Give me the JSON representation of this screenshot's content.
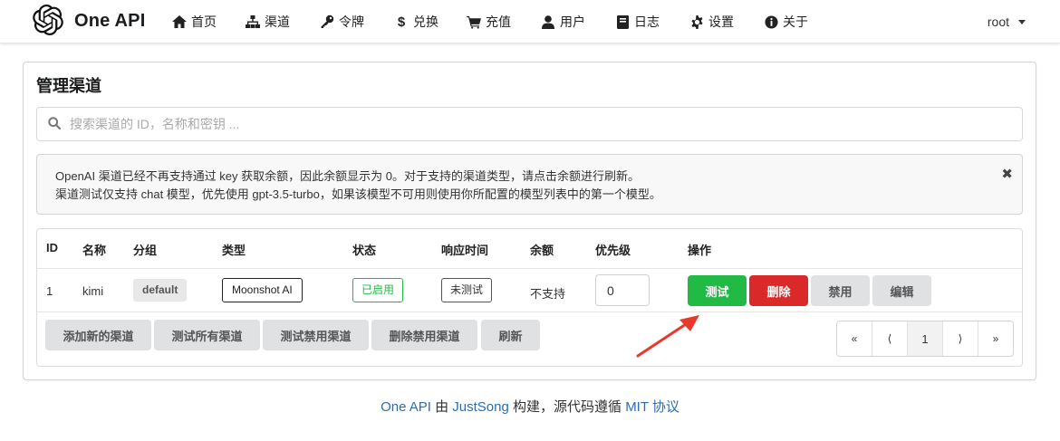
{
  "brand": {
    "name": "One API"
  },
  "nav": [
    {
      "label": "首页",
      "icon": "home-icon"
    },
    {
      "label": "渠道",
      "icon": "sitemap-icon"
    },
    {
      "label": "令牌",
      "icon": "key-icon"
    },
    {
      "label": "兑换",
      "icon": "dollar-icon"
    },
    {
      "label": "充值",
      "icon": "cart-icon"
    },
    {
      "label": "用户",
      "icon": "user-icon"
    },
    {
      "label": "日志",
      "icon": "book-icon"
    },
    {
      "label": "设置",
      "icon": "gear-icon"
    },
    {
      "label": "关于",
      "icon": "info-icon"
    }
  ],
  "user": {
    "name": "root"
  },
  "page": {
    "title": "管理渠道",
    "search_placeholder": "搜索渠道的 ID，名称和密钥 ...",
    "notice_line1": "OpenAI 渠道已经不再支持通过 key 获取余额，因此余额显示为 0。对于支持的渠道类型，请点击余额进行刷新。",
    "notice_line2": "渠道测试仅支持 chat 模型，优先使用 gpt-3.5-turbo，如果该模型不可用则使用你所配置的模型列表中的第一个模型。",
    "notice_close": "✖"
  },
  "table": {
    "headers": [
      "ID",
      "名称",
      "分组",
      "类型",
      "状态",
      "响应时间",
      "余额",
      "优先级",
      "操作"
    ],
    "rows": [
      {
        "id": "1",
        "name": "kimi",
        "group": "default",
        "type": "Moonshot AI",
        "status": "已启用",
        "response_time": "未测试",
        "balance": "不支持",
        "priority": "0",
        "actions": {
          "test": "测试",
          "delete": "删除",
          "disable": "禁用",
          "edit": "编辑"
        }
      }
    ]
  },
  "footer_buttons": [
    "添加新的渠道",
    "测试所有渠道",
    "测试禁用渠道",
    "删除禁用渠道",
    "刷新"
  ],
  "pagination": {
    "first": "«",
    "prev": "⟨",
    "current": "1",
    "next": "⟩",
    "last": "»"
  },
  "footer": {
    "brand_link": "One API",
    "by": " 由 ",
    "author_link": "JustSong",
    "built": " 构建，源代码遵循 ",
    "license_link": "MIT 协议"
  },
  "colors": {
    "green": "#21ba45",
    "red": "#db2828",
    "grey": "#e0e1e2",
    "link": "#2a6db4",
    "arrow": "#e8392b"
  }
}
